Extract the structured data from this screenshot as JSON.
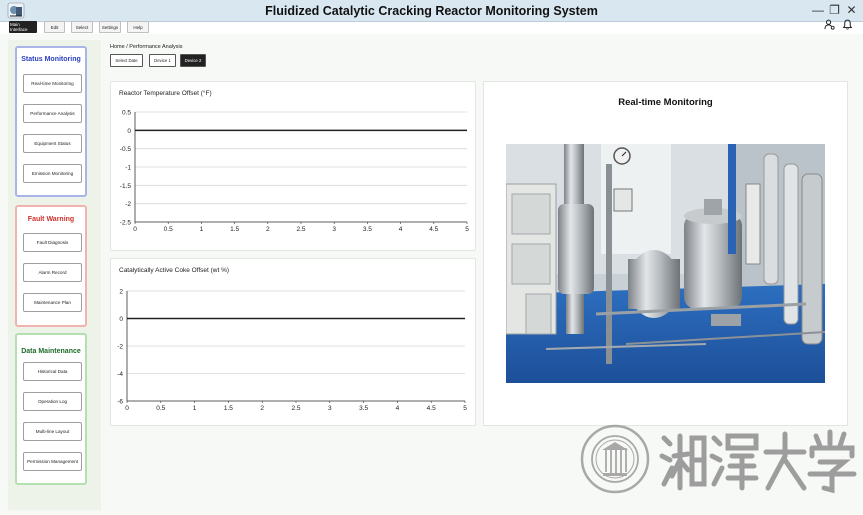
{
  "window": {
    "title": "Fluidized Catalytic Cracking Reactor Monitoring System",
    "controls": [
      "—",
      "❐",
      "✕"
    ]
  },
  "menu": [
    "Main Interface",
    "Edit",
    "Select",
    "Settings",
    "Help"
  ],
  "sidebar": {
    "status": {
      "title": "Status Monitoring",
      "color": "#2b3fbf",
      "items": [
        "Real-time Monitoring",
        "Performance Analysis",
        "Equipment Status",
        "Emission Monitoring"
      ]
    },
    "fault": {
      "title": "Fault Warning",
      "color": "#d0312d",
      "items": [
        "Fault Diagnosis",
        "Alarm Record",
        "Maintenance Plan"
      ]
    },
    "data": {
      "title": "Data Maintenance",
      "color": "#1f6b2a",
      "items": [
        "Historical Data",
        "Operation Log",
        "Multi-line Layout",
        "Permission Management"
      ]
    }
  },
  "breadcrumb": "Home / Performance Analysis",
  "device_buttons": [
    "Select Date",
    "Device 1",
    "Device 2"
  ],
  "realtime_title": "Real-time Monitoring",
  "watermark": {
    "characters": "湘潭大學"
  },
  "chart_data": [
    {
      "type": "line",
      "title": "Reactor Temperature Offset (°F)",
      "x": [
        0,
        0.5,
        1,
        1.5,
        2,
        2.5,
        3,
        3.5,
        4,
        4.5,
        5
      ],
      "series": [
        {
          "values": [
            0,
            0,
            0,
            0,
            0,
            0,
            0,
            0,
            0,
            0,
            0
          ]
        }
      ],
      "xlim": [
        0,
        5
      ],
      "ylim": [
        -2.5,
        0.5
      ],
      "xticks": [
        "0",
        "0.5",
        "1",
        "1.5",
        "2",
        "2.5",
        "3",
        "3.5",
        "4",
        "4.5",
        "5"
      ],
      "yticks": [
        "0.5",
        "0",
        "-0.5",
        "-1",
        "-1.5",
        "-2",
        "-2.5"
      ],
      "grid": true
    },
    {
      "type": "line",
      "title": "Catalytically Active Coke Offset (wt %)",
      "x": [
        0,
        0.5,
        1,
        1.5,
        2,
        2.5,
        3,
        3.5,
        4,
        4.5,
        5
      ],
      "series": [
        {
          "values": [
            0,
            0,
            0,
            0,
            0,
            0,
            0,
            0,
            0,
            0,
            0
          ]
        }
      ],
      "xlim": [
        0,
        5
      ],
      "ylim": [
        -6,
        2
      ],
      "xticks": [
        "0",
        "0.5",
        "1",
        "1.5",
        "2",
        "2.5",
        "3",
        "3.5",
        "4",
        "4.5",
        "5"
      ],
      "yticks": [
        "2",
        "0",
        "-2",
        "-4",
        "-6"
      ],
      "grid": true
    }
  ]
}
